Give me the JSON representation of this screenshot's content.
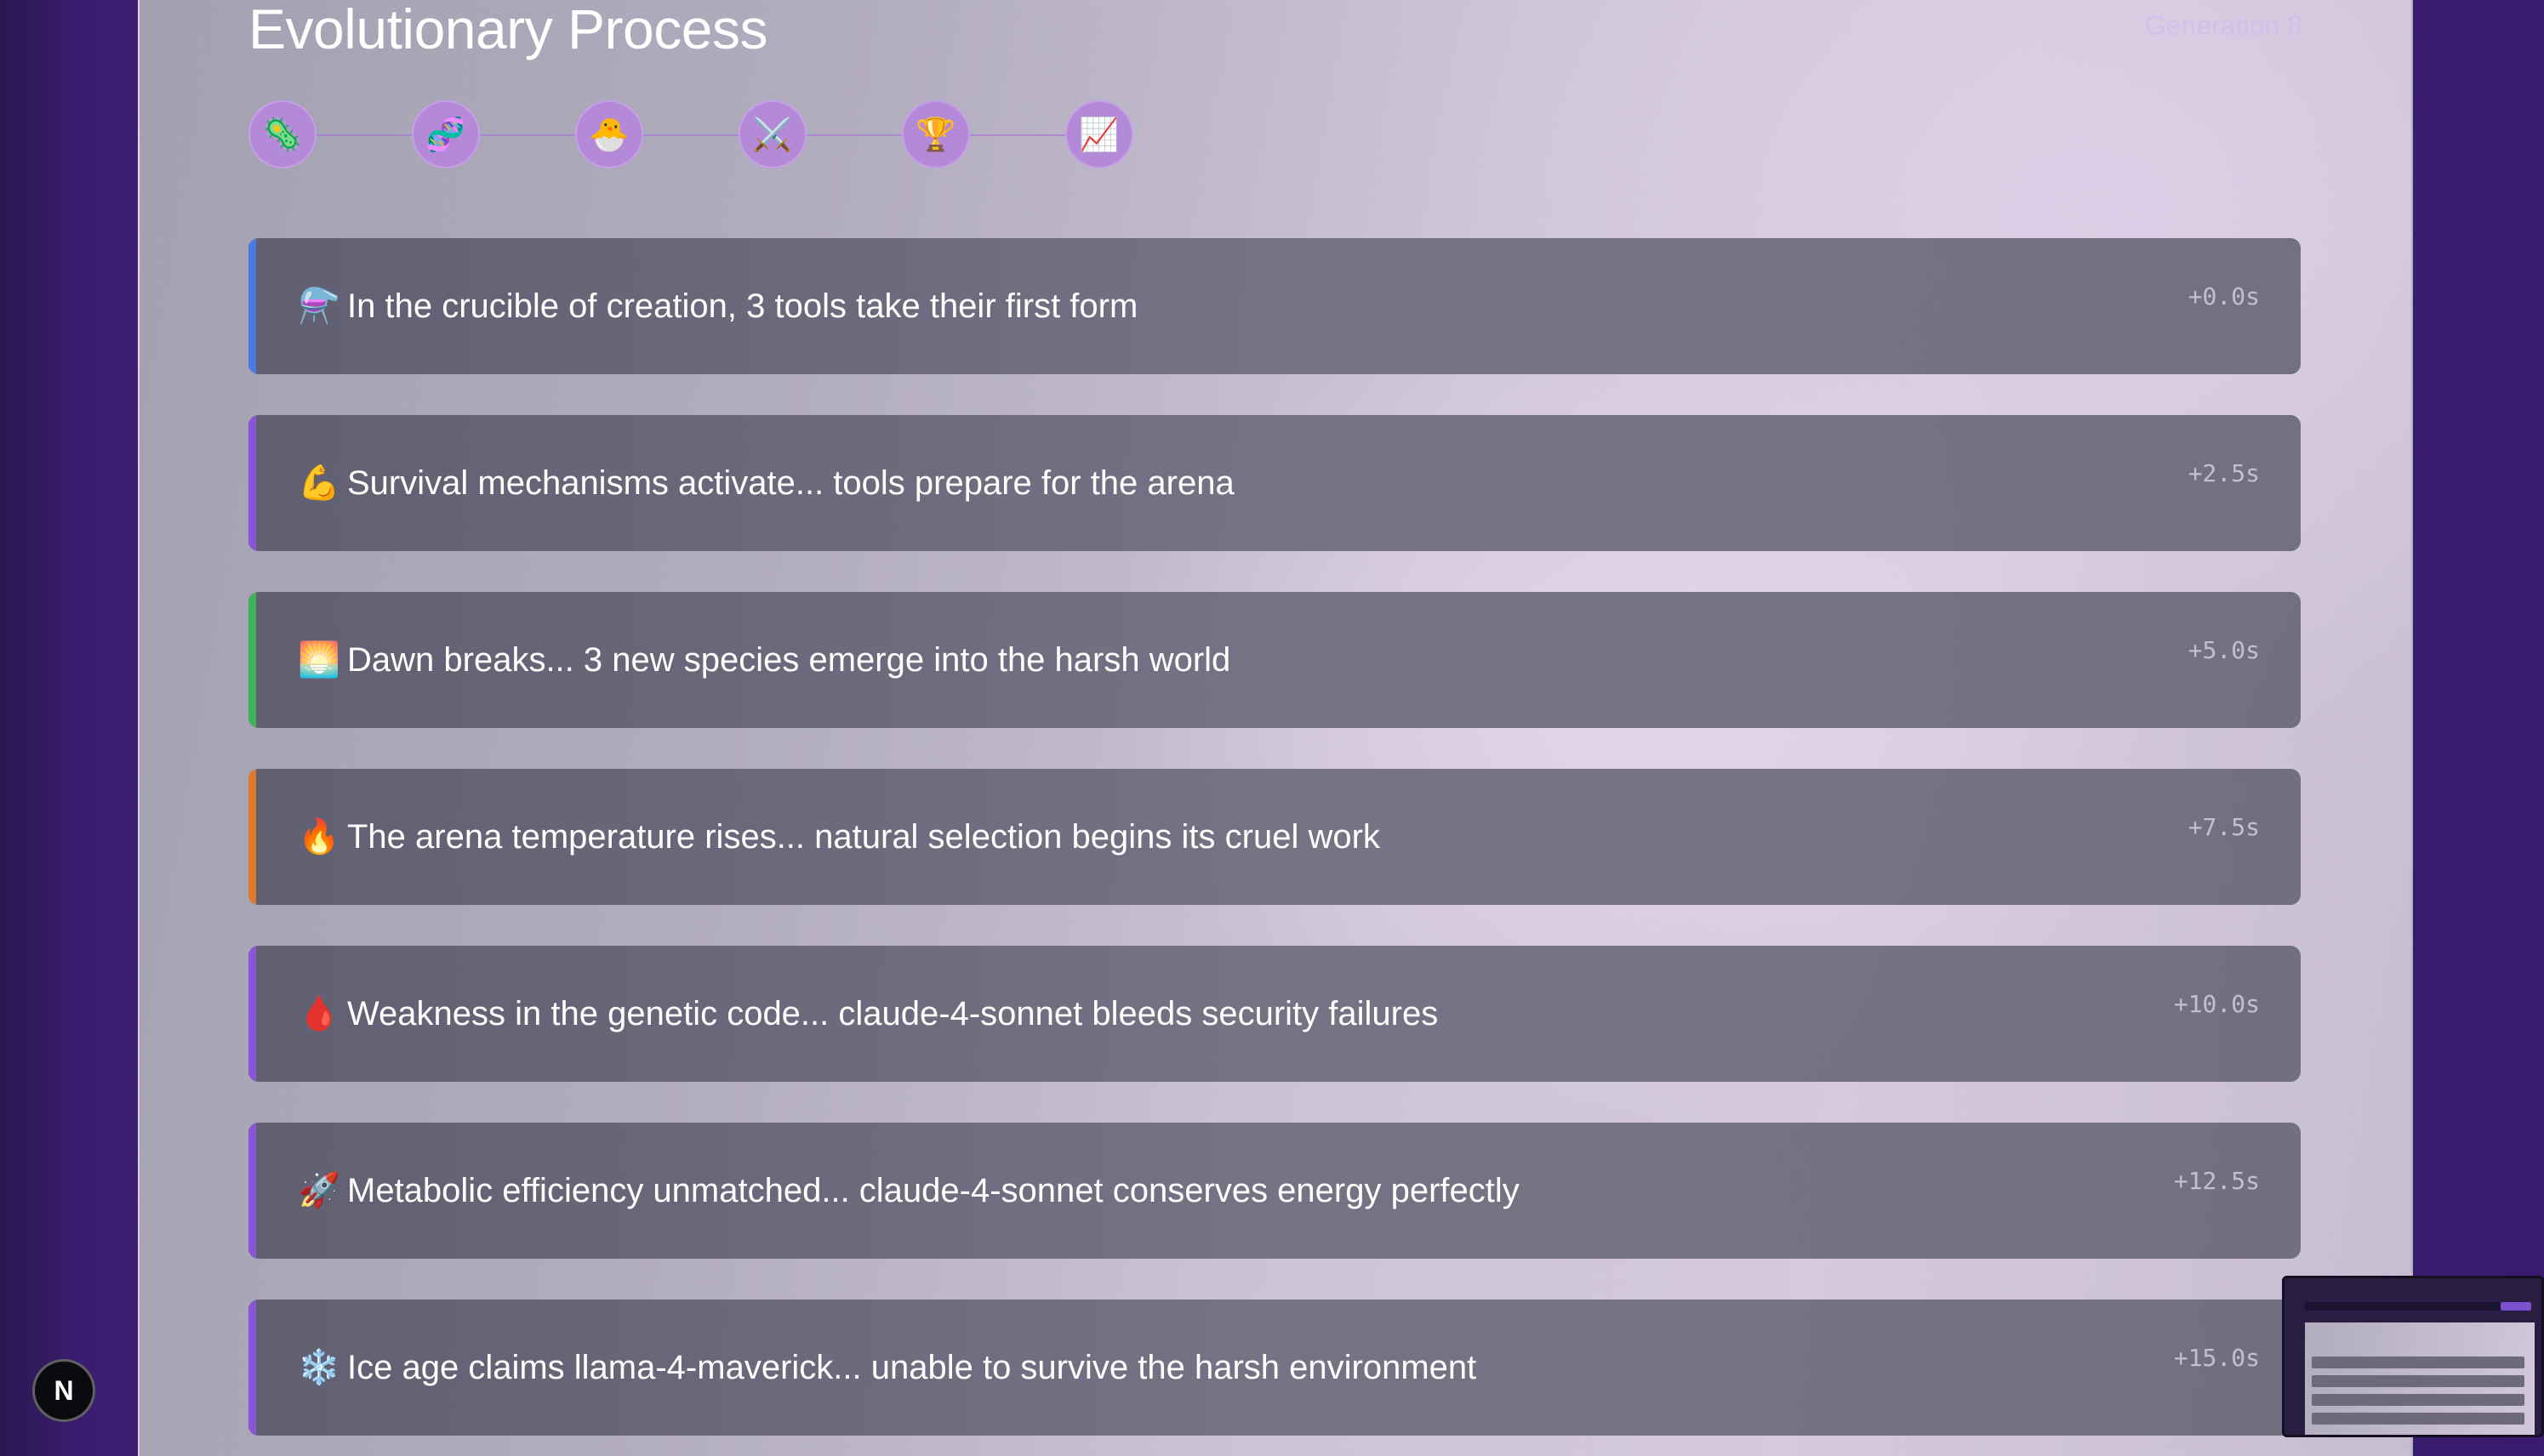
{
  "header": {
    "title": "Evolutionary Process",
    "generation": "Generation 8"
  },
  "stages": [
    {
      "icon": "microbe-icon",
      "glyph": "🦠"
    },
    {
      "icon": "dna-icon",
      "glyph": "🧬"
    },
    {
      "icon": "hatching-chick-icon",
      "glyph": "🐣"
    },
    {
      "icon": "crossed-swords-icon",
      "glyph": "⚔️"
    },
    {
      "icon": "trophy-icon",
      "glyph": "🏆"
    },
    {
      "icon": "chart-increasing-icon",
      "glyph": "📈"
    }
  ],
  "events": [
    {
      "emoji": "⚗️",
      "icon": "alembic-icon",
      "text": "In the crucible of creation, 3 tools take their first form",
      "time": "+0.0s",
      "accent": "#4a7be0"
    },
    {
      "emoji": "💪",
      "icon": "flexed-biceps-icon",
      "text": "Survival mechanisms activate... tools prepare for the arena",
      "time": "+2.5s",
      "accent": "#8a55d8"
    },
    {
      "emoji": "🌅",
      "icon": "sunrise-icon",
      "text": "Dawn breaks... 3 new species emerge into the harsh world",
      "time": "+5.0s",
      "accent": "#3fb35a"
    },
    {
      "emoji": "🔥",
      "icon": "fire-icon",
      "text": "The arena temperature rises... natural selection begins its cruel work",
      "time": "+7.5s",
      "accent": "#e07a2a"
    },
    {
      "emoji": "🩸",
      "icon": "drop-of-blood-icon",
      "text": "Weakness in the genetic code... claude-4-sonnet bleeds security failures",
      "time": "+10.0s",
      "accent": "#8a55d8"
    },
    {
      "emoji": "🚀",
      "icon": "rocket-icon",
      "text": "Metabolic efficiency unmatched... claude-4-sonnet conserves energy perfectly",
      "time": "+12.5s",
      "accent": "#8a55d8"
    },
    {
      "emoji": "❄️",
      "icon": "snowflake-icon",
      "text": "Ice age claims llama-4-maverick... unable to survive the harsh environment",
      "time": "+15.0s",
      "accent": "#8a55d8"
    }
  ],
  "badge": {
    "label": "N"
  }
}
